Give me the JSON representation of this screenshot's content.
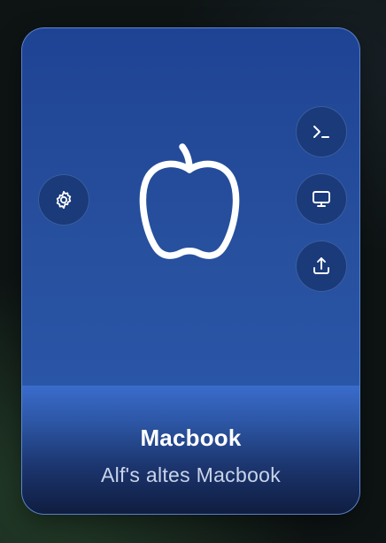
{
  "device": {
    "name": "Macbook",
    "description": "Alf's altes Macbook",
    "logo_icon": "apple-logo-icon"
  },
  "actions": {
    "settings_icon": "gear-icon",
    "terminal_icon": "terminal-icon",
    "display_icon": "monitor-icon",
    "share_icon": "upload-icon"
  },
  "colors": {
    "card_top": "#1f4394",
    "card_bottom": "#2c5aac",
    "button_bg": "#1a3a7a",
    "border": "#6e96dc",
    "text_primary": "#ffffff",
    "text_secondary": "#c9d4ea"
  }
}
